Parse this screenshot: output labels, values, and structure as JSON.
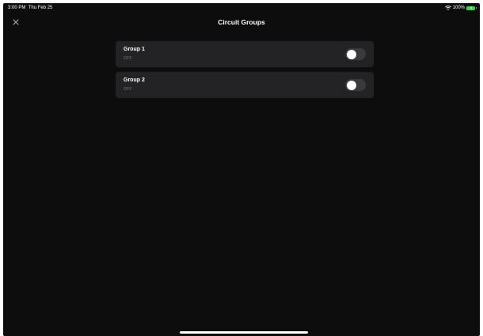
{
  "status_bar": {
    "time": "3:00 PM",
    "date": "Thu Feb 25",
    "battery_percent": "100%",
    "wifi_icon": "wifi-icon",
    "battery_icon": "battery-charging-icon",
    "battery_color": "#32d74b"
  },
  "header": {
    "title": "Circuit Groups",
    "close_icon": "close-icon"
  },
  "groups": [
    {
      "name": "Group 1",
      "status": "OFF",
      "toggle_on": false
    },
    {
      "name": "Group 2",
      "status": "OFF",
      "toggle_on": false
    }
  ],
  "colors": {
    "background": "#0d0d0d",
    "card": "#232325",
    "toggle_off": "#3a3a3c"
  }
}
